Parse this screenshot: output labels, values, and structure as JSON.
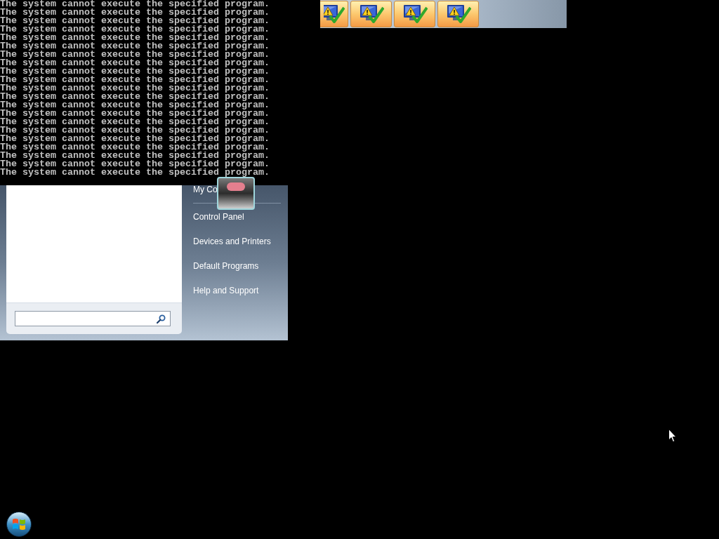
{
  "console": {
    "lines": [
      "The system cannot execute the specified program.",
      "The system cannot execute the specified program.",
      "The system cannot execute the specified program.",
      "The system cannot execute the specified program.",
      "The system cannot execute the specified program.",
      "The system cannot execute the specified program.",
      "The system cannot execute the specified program.",
      "The system cannot execute the specified program.",
      "The system cannot execute the specified program.",
      "The system cannot execute the specified program.",
      "The system cannot execute the specified program.",
      "The system cannot execute the specified program.",
      "The system cannot execute the specified program.",
      "The system cannot execute the specified program.",
      "The system cannot execute the specified program.",
      "The system cannot execute the specified program.",
      "The system cannot execute the specified program.",
      "The system cannot execute the specified program.",
      "The system cannot execute the specified program.",
      "The system cannot execute the specified program.",
      "The system cannot execute the specified program."
    ]
  },
  "start_menu": {
    "links": [
      "My Co",
      "Control Panel",
      "Devices and Printers",
      "Default Programs",
      "Help and Support"
    ]
  }
}
